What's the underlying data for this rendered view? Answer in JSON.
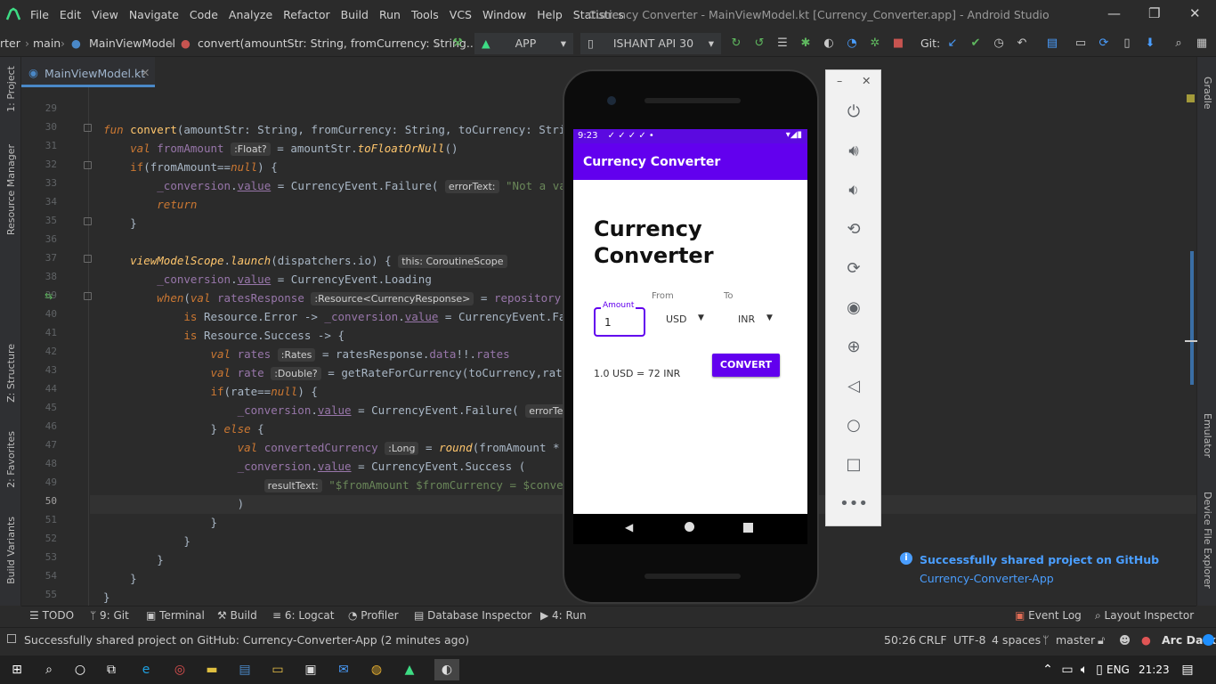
{
  "menubar": {
    "items": [
      "File",
      "Edit",
      "View",
      "Navigate",
      "Code",
      "Analyze",
      "Refactor",
      "Build",
      "Run",
      "Tools",
      "VCS",
      "Window",
      "Help",
      "Statistics"
    ],
    "title": "Currency Converter - MainViewModel.kt [Currency_Converter.app] - Android Studio"
  },
  "navbar": {
    "crumbs": [
      "rter",
      "main",
      "MainViewModel",
      "convert(amountStr: String, fromCurrency: String..."
    ],
    "run_config": "APP",
    "device": "ISHANT API 30",
    "git_label": "Git:"
  },
  "editor": {
    "tab": "MainViewModel.kt",
    "line_numbers": [
      "29",
      "30",
      "31",
      "32",
      "33",
      "34",
      "35",
      "36",
      "37",
      "38",
      "39",
      "40",
      "41",
      "42",
      "43",
      "44",
      "45",
      "46",
      "47",
      "48",
      "49",
      "50",
      "51",
      "52",
      "53",
      "54",
      "55"
    ],
    "current_line": "50"
  },
  "left_strip": [
    "1: Project",
    "Resource Manager",
    "Z: Structure",
    "2: Favorites",
    "Build Variants"
  ],
  "right_strip": [
    "Gradle",
    "Emulator",
    "Device File Explorer"
  ],
  "emulator": {
    "status_time": "9:23",
    "app_title": "Currency Converter",
    "heading_line1": "Currency",
    "heading_line2": "Converter",
    "amount_label": "Amount",
    "amount_value": "1",
    "from_label": "From",
    "from_value": "USD",
    "to_label": "To",
    "to_value": "INR",
    "convert_button": "CONVERT",
    "result": "1.0 USD = 72 INR"
  },
  "notification": {
    "title": "Successfully shared project on GitHub",
    "link": "Currency-Converter-App"
  },
  "toolwindows": [
    "TODO",
    "9: Git",
    "Terminal",
    "Build",
    "6: Logcat",
    "Profiler",
    "Database Inspector",
    "4: Run"
  ],
  "toolwindows_right": [
    "Event Log",
    "Layout Inspector"
  ],
  "statusbar": {
    "message": "Successfully shared project on GitHub: Currency-Converter-App (2 minutes ago)",
    "position": "50:26",
    "line_sep": "CRLF",
    "encoding": "UTF-8",
    "indent": "4 spaces",
    "branch": "master",
    "theme": "Arc Dark"
  },
  "taskbar": {
    "lang": "ENG",
    "time": "21:23"
  },
  "colors": {
    "accent": "#6200ee",
    "status": "#5b0ae0",
    "ide_bg": "#2b2b2b",
    "link": "#4a9eff"
  }
}
